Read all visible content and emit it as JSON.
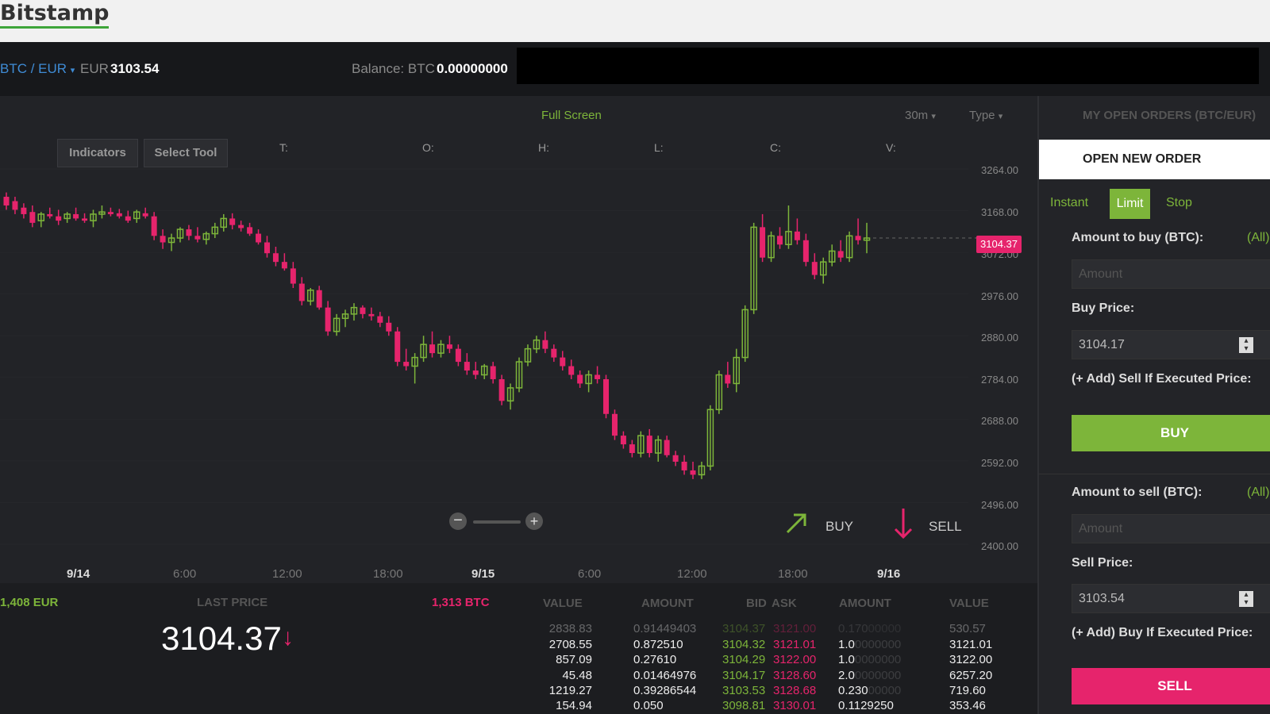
{
  "header": {
    "logo_text": "Bitstamp"
  },
  "market": {
    "pair": "BTC / EUR",
    "eur_label": "EUR",
    "eur_price": "3103.54",
    "balance_label": "Balance: BTC",
    "balance_value": "0.00000000"
  },
  "chart_toolbar": {
    "full_screen": "Full Screen",
    "interval": "30m",
    "type": "Type",
    "indicators": "Indicators",
    "select_tool": "Select Tool",
    "ohlc_labels": [
      "T:",
      "O:",
      "H:",
      "L:",
      "C:",
      "V:"
    ]
  },
  "chart_data": {
    "type": "candlestick",
    "ylim": [
      2400,
      3264
    ],
    "y_ticks": [
      "3264.00",
      "3168.00",
      "3072.00",
      "2976.00",
      "2880.00",
      "2784.00",
      "2688.00",
      "2592.00",
      "2496.00",
      "2400.00"
    ],
    "x_ticks": [
      "9/14",
      "6:00",
      "12:00",
      "18:00",
      "9/15",
      "6:00",
      "12:00",
      "18:00",
      "9/16"
    ],
    "x_date_ticks": [
      "9/14",
      "9/15",
      "9/16"
    ],
    "last_price_tag": "3104.37",
    "up_color": "#7db53a",
    "down_color": "#e6246c",
    "candles": [
      [
        3200,
        3210,
        3170,
        3180
      ],
      [
        3190,
        3200,
        3160,
        3170
      ],
      [
        3175,
        3185,
        3150,
        3160
      ],
      [
        3165,
        3180,
        3130,
        3140
      ],
      [
        3145,
        3165,
        3130,
        3160
      ],
      [
        3160,
        3175,
        3150,
        3155
      ],
      [
        3155,
        3170,
        3135,
        3145
      ],
      [
        3150,
        3165,
        3140,
        3160
      ],
      [
        3160,
        3175,
        3145,
        3150
      ],
      [
        3150,
        3162,
        3140,
        3145
      ],
      [
        3145,
        3170,
        3130,
        3160
      ],
      [
        3160,
        3180,
        3150,
        3165
      ],
      [
        3165,
        3175,
        3155,
        3160
      ],
      [
        3162,
        3172,
        3150,
        3155
      ],
      [
        3155,
        3168,
        3140,
        3145
      ],
      [
        3150,
        3170,
        3140,
        3165
      ],
      [
        3162,
        3175,
        3150,
        3155
      ],
      [
        3155,
        3165,
        3100,
        3110
      ],
      [
        3110,
        3125,
        3080,
        3095
      ],
      [
        3095,
        3115,
        3075,
        3105
      ],
      [
        3105,
        3130,
        3095,
        3125
      ],
      [
        3125,
        3135,
        3100,
        3110
      ],
      [
        3110,
        3130,
        3095,
        3102
      ],
      [
        3102,
        3120,
        3090,
        3115
      ],
      [
        3115,
        3140,
        3105,
        3130
      ],
      [
        3130,
        3160,
        3120,
        3150
      ],
      [
        3150,
        3162,
        3125,
        3135
      ],
      [
        3135,
        3145,
        3120,
        3128
      ],
      [
        3130,
        3140,
        3110,
        3115
      ],
      [
        3115,
        3125,
        3090,
        3095
      ],
      [
        3095,
        3110,
        3060,
        3070
      ],
      [
        3070,
        3085,
        3040,
        3050
      ],
      [
        3050,
        3070,
        3030,
        3035
      ],
      [
        3035,
        3050,
        2990,
        3000
      ],
      [
        3000,
        3015,
        2950,
        2960
      ],
      [
        2960,
        2990,
        2950,
        2985
      ],
      [
        2985,
        2995,
        2940,
        2945
      ],
      [
        2945,
        2960,
        2880,
        2890
      ],
      [
        2890,
        2930,
        2880,
        2920
      ],
      [
        2920,
        2940,
        2900,
        2930
      ],
      [
        2930,
        2955,
        2915,
        2945
      ],
      [
        2945,
        2950,
        2920,
        2930
      ],
      [
        2930,
        2945,
        2915,
        2925
      ],
      [
        2925,
        2935,
        2900,
        2910
      ],
      [
        2910,
        2925,
        2880,
        2890
      ],
      [
        2890,
        2900,
        2810,
        2820
      ],
      [
        2820,
        2850,
        2800,
        2810
      ],
      [
        2810,
        2840,
        2770,
        2830
      ],
      [
        2830,
        2880,
        2820,
        2860
      ],
      [
        2860,
        2890,
        2830,
        2840
      ],
      [
        2840,
        2870,
        2830,
        2860
      ],
      [
        2860,
        2880,
        2840,
        2850
      ],
      [
        2850,
        2860,
        2810,
        2820
      ],
      [
        2820,
        2840,
        2790,
        2800
      ],
      [
        2800,
        2820,
        2780,
        2790
      ],
      [
        2790,
        2815,
        2780,
        2810
      ],
      [
        2810,
        2820,
        2770,
        2780
      ],
      [
        2780,
        2790,
        2720,
        2730
      ],
      [
        2730,
        2770,
        2710,
        2760
      ],
      [
        2760,
        2830,
        2750,
        2820
      ],
      [
        2820,
        2860,
        2810,
        2850
      ],
      [
        2850,
        2880,
        2840,
        2870
      ],
      [
        2870,
        2890,
        2840,
        2850
      ],
      [
        2850,
        2860,
        2820,
        2830
      ],
      [
        2830,
        2845,
        2800,
        2810
      ],
      [
        2810,
        2825,
        2780,
        2790
      ],
      [
        2790,
        2800,
        2760,
        2770
      ],
      [
        2770,
        2800,
        2750,
        2790
      ],
      [
        2790,
        2810,
        2770,
        2780
      ],
      [
        2780,
        2790,
        2690,
        2700
      ],
      [
        2700,
        2710,
        2640,
        2650
      ],
      [
        2650,
        2660,
        2620,
        2630
      ],
      [
        2630,
        2640,
        2600,
        2610
      ],
      [
        2610,
        2660,
        2600,
        2650
      ],
      [
        2650,
        2665,
        2600,
        2610
      ],
      [
        2610,
        2650,
        2590,
        2640
      ],
      [
        2640,
        2650,
        2600,
        2605
      ],
      [
        2605,
        2615,
        2580,
        2590
      ],
      [
        2590,
        2605,
        2560,
        2570
      ],
      [
        2570,
        2590,
        2550,
        2560
      ],
      [
        2560,
        2590,
        2550,
        2580
      ],
      [
        2580,
        2720,
        2570,
        2710
      ],
      [
        2710,
        2800,
        2700,
        2790
      ],
      [
        2790,
        2820,
        2760,
        2770
      ],
      [
        2770,
        2850,
        2750,
        2830
      ],
      [
        2830,
        2950,
        2820,
        2940
      ],
      [
        2940,
        3140,
        2930,
        3130
      ],
      [
        3130,
        3160,
        3050,
        3060
      ],
      [
        3060,
        3120,
        3050,
        3110
      ],
      [
        3110,
        3130,
        3080,
        3090
      ],
      [
        3090,
        3180,
        3080,
        3120
      ],
      [
        3120,
        3150,
        3090,
        3100
      ],
      [
        3100,
        3115,
        3040,
        3050
      ],
      [
        3050,
        3070,
        3010,
        3020
      ],
      [
        3020,
        3060,
        3000,
        3050
      ],
      [
        3050,
        3090,
        3040,
        3075
      ],
      [
        3075,
        3100,
        3050,
        3060
      ],
      [
        3060,
        3120,
        3050,
        3110
      ],
      [
        3110,
        3150,
        3090,
        3100
      ],
      [
        3100,
        3140,
        3070,
        3105
      ]
    ]
  },
  "chart_controls": {
    "zoom_out": "−",
    "zoom_in": "+",
    "buy": "BUY",
    "sell": "SELL"
  },
  "bottom": {
    "eur_volume": "1,408 EUR",
    "last_price_label": "LAST PRICE",
    "btc_volume": "1,313 BTC",
    "last_price": "3104.37",
    "last_price_arrow": "↓",
    "columns": [
      "VALUE",
      "AMOUNT",
      "BID",
      "ASK",
      "AMOUNT",
      "VALUE"
    ],
    "orderbook": [
      {
        "value": "2838.83",
        "amount": "0.91449403",
        "bid": "3104.37",
        "ask": "3121.00",
        "amount2": "0.170",
        "amount2_faded": "00000",
        "value2": "530.57",
        "faded": true
      },
      {
        "value": "2708.55",
        "amount": "0.872510",
        "bid": "3104.32",
        "ask": "3121.01",
        "amount2": "1.0",
        "amount2_faded": "0000000",
        "value2": "3121.01",
        "faded": false
      },
      {
        "value": "857.09",
        "amount": "0.27610",
        "bid": "3104.29",
        "ask": "3122.00",
        "amount2": "1.0",
        "amount2_faded": "0000000",
        "value2": "3122.00",
        "faded": false
      },
      {
        "value": "45.48",
        "amount": "0.01464976",
        "bid": "3104.17",
        "ask": "3128.60",
        "amount2": "2.0",
        "amount2_faded": "0000000",
        "value2": "6257.20",
        "faded": false
      },
      {
        "value": "1219.27",
        "amount": "0.39286544",
        "bid": "3103.53",
        "ask": "3128.68",
        "amount2": "0.230",
        "amount2_faded": "00000",
        "value2": "719.60",
        "faded": false
      },
      {
        "value": "154.94",
        "amount": "0.050",
        "bid": "3098.81",
        "ask": "3130.01",
        "amount2": "0.1129250",
        "amount2_faded": "",
        "value2": "353.46",
        "faded": false
      }
    ]
  },
  "order_panel": {
    "my_open_orders": "MY OPEN ORDERS (BTC/EUR)",
    "open_new_order": "OPEN NEW ORDER",
    "tabs": [
      "Instant",
      "Limit",
      "Stop"
    ],
    "buy": {
      "amount_label": "Amount to buy (BTC):",
      "all": "(All)",
      "amount_placeholder": "Amount",
      "price_label": "Buy Price:",
      "price_value": "3104.17",
      "add_label": "(+ Add) Sell If Executed Price:",
      "button": "BUY"
    },
    "sell": {
      "amount_label": "Amount to sell (BTC):",
      "all": "(All)",
      "amount_placeholder": "Amount",
      "price_label": "Sell Price:",
      "price_value": "3103.54",
      "add_label": "(+ Add) Buy If Executed Price:",
      "button": "SELL"
    }
  }
}
